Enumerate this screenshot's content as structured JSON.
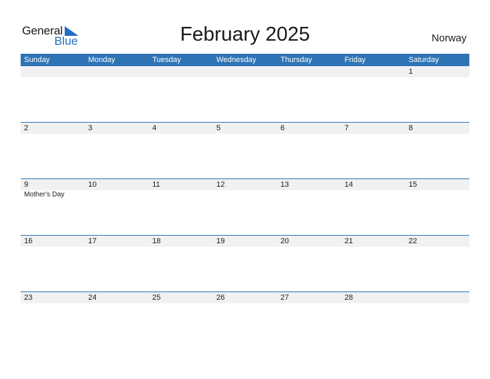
{
  "logo": {
    "general": "General",
    "blue": "Blue",
    "accent": "#1f6fbf"
  },
  "title": "February 2025",
  "country": "Norway",
  "colors": {
    "header": "#2e74b5",
    "strip": "#f1f1f1"
  },
  "weekdays": [
    "Sunday",
    "Monday",
    "Tuesday",
    "Wednesday",
    "Thursday",
    "Friday",
    "Saturday"
  ],
  "weeks": [
    {
      "days": [
        "",
        "",
        "",
        "",
        "",
        "",
        "1"
      ],
      "events": [
        "",
        "",
        "",
        "",
        "",
        "",
        ""
      ]
    },
    {
      "days": [
        "2",
        "3",
        "4",
        "5",
        "6",
        "7",
        "8"
      ],
      "events": [
        "",
        "",
        "",
        "",
        "",
        "",
        ""
      ]
    },
    {
      "days": [
        "9",
        "10",
        "11",
        "12",
        "13",
        "14",
        "15"
      ],
      "events": [
        "Mother's Day",
        "",
        "",
        "",
        "",
        "",
        ""
      ]
    },
    {
      "days": [
        "16",
        "17",
        "18",
        "19",
        "20",
        "21",
        "22"
      ],
      "events": [
        "",
        "",
        "",
        "",
        "",
        "",
        ""
      ]
    },
    {
      "days": [
        "23",
        "24",
        "25",
        "26",
        "27",
        "28",
        ""
      ],
      "events": [
        "",
        "",
        "",
        "",
        "",
        "",
        ""
      ]
    }
  ]
}
